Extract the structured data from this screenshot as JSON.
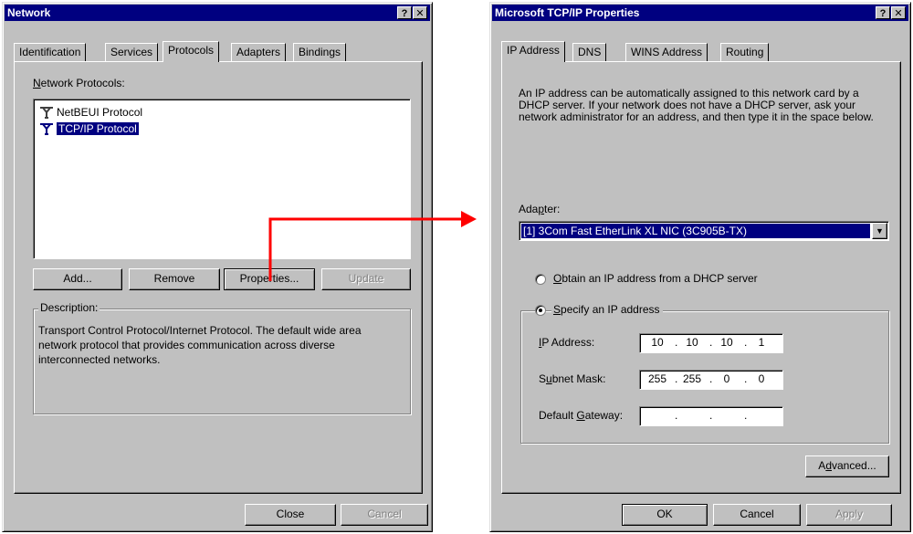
{
  "network_dialog": {
    "title": "Network",
    "tabs": [
      "Identification",
      "Services",
      "Protocols",
      "Adapters",
      "Bindings"
    ],
    "active_tab": "Protocols",
    "protocols_label": "Network Protocols:",
    "protocols": [
      {
        "name": "NetBEUI Protocol",
        "selected": false
      },
      {
        "name": "TCP/IP Protocol",
        "selected": true
      }
    ],
    "buttons": {
      "add": "Add...",
      "remove": "Remove",
      "properties": "Properties...",
      "update": "Update"
    },
    "description_label": "Description:",
    "description_text": "Transport Control Protocol/Internet Protocol. The default wide area network protocol that provides communication across diverse interconnected networks.",
    "footer": {
      "close": "Close",
      "cancel": "Cancel"
    }
  },
  "tcpip_dialog": {
    "title": "Microsoft TCP/IP Properties",
    "tabs": [
      "IP Address",
      "DNS",
      "WINS Address",
      "Routing"
    ],
    "active_tab": "IP Address",
    "intro_text": "An IP address can be automatically assigned to this network card by a DHCP server.  If your network does not have a DHCP server, ask your network administrator for an address, and then type it in the space below.",
    "adapter_label": "Adapter:",
    "adapter_value": "[1] 3Com Fast EtherLink XL NIC (3C905B-TX)",
    "radio_dhcp": "Obtain an IP address from a DHCP server",
    "radio_specify": "Specify an IP address",
    "selected_radio": "specify",
    "ip_address_label": "IP Address:",
    "ip_address": [
      "10",
      "10",
      "10",
      "1"
    ],
    "subnet_label": "Subnet Mask:",
    "subnet_mask": [
      "255",
      "255",
      "0",
      "0"
    ],
    "gateway_label": "Default Gateway:",
    "gateway": [
      "",
      "",
      "",
      ""
    ],
    "advanced_button": "Advanced...",
    "footer": {
      "ok": "OK",
      "cancel": "Cancel",
      "apply": "Apply"
    }
  },
  "annotation_arrow_color": "#ff0000"
}
